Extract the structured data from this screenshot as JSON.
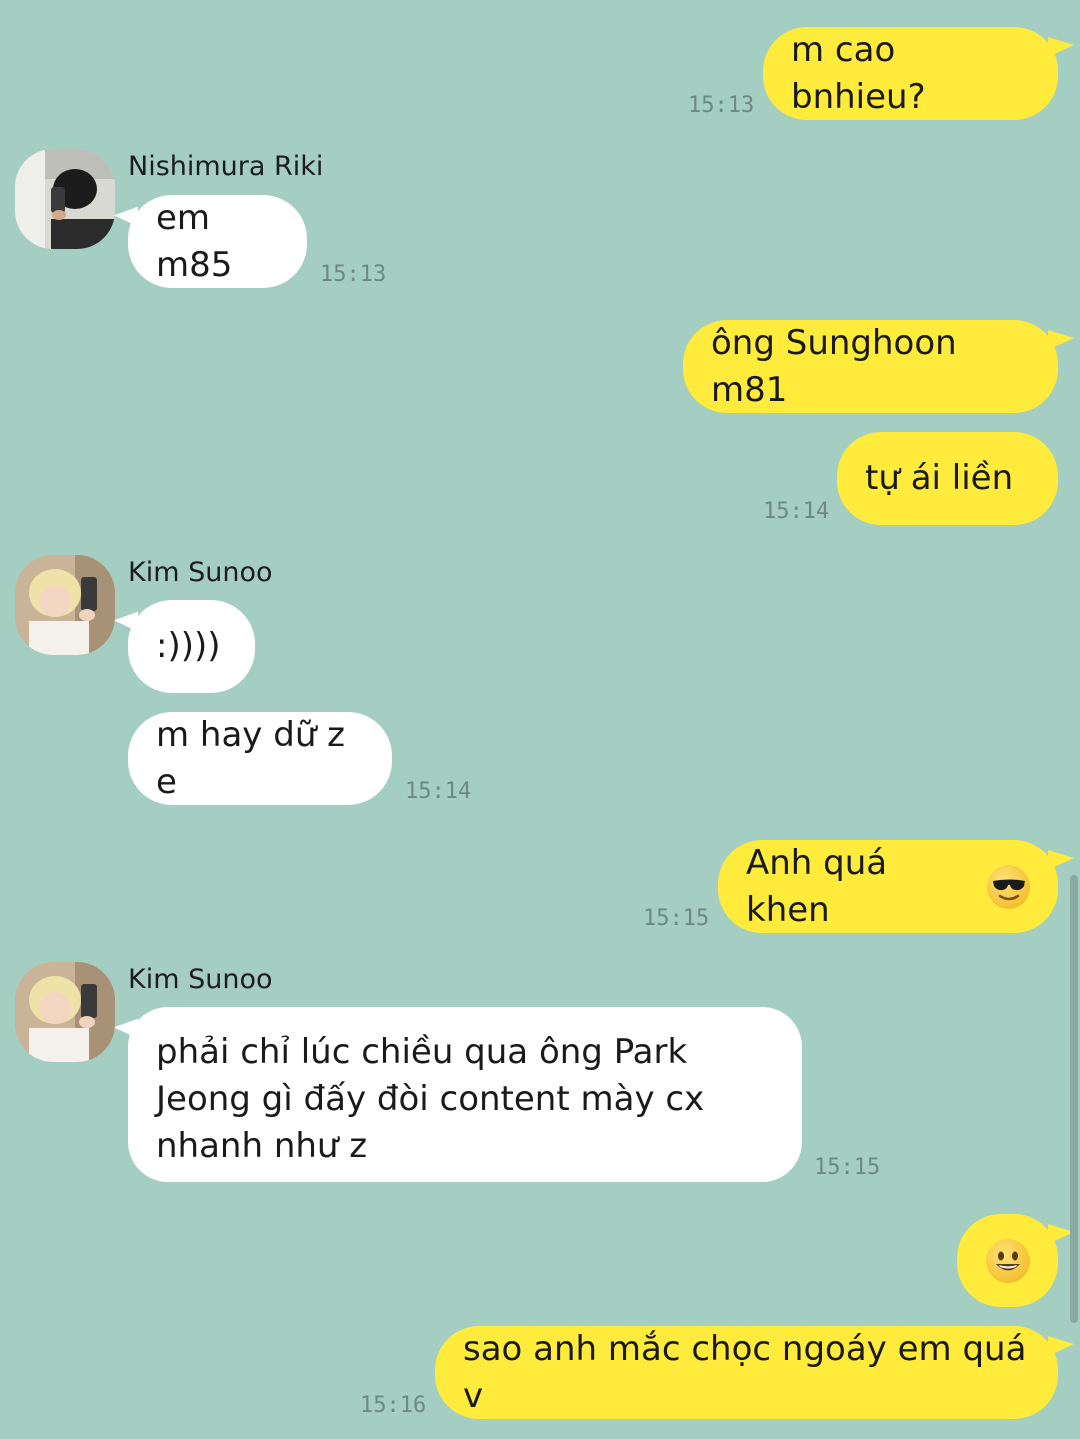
{
  "colors": {
    "background": "#a5cec2",
    "my_bubble": "#ffeb3b",
    "their_bubble": "#ffffff",
    "timestamp": "#6a8a83"
  },
  "messages": [
    {
      "sender": "me",
      "text": "m cao bnhieu?",
      "time": "15:13"
    },
    {
      "sender": "Nishimura Riki",
      "text": "em m85",
      "time": "15:13"
    },
    {
      "sender": "me",
      "text": "ông Sunghoon m81"
    },
    {
      "sender": "me",
      "text": "tự ái liền",
      "time": "15:14"
    },
    {
      "sender": "Kim Sunoo",
      "text": ":))))"
    },
    {
      "sender": "Kim Sunoo",
      "text": "m hay dữ z e",
      "time": "15:14"
    },
    {
      "sender": "me",
      "text": "Anh quá khen",
      "emoji": "sunglasses-face",
      "time": "15:15"
    },
    {
      "sender": "Kim Sunoo",
      "text_lines": [
        "phải chỉ lúc chiều qua ông Park",
        "Jeong gì đấy đòi content mày cx",
        "nhanh như z"
      ],
      "time": "15:15"
    },
    {
      "sender": "me",
      "emoji": "grinning-face"
    },
    {
      "sender": "me",
      "text": "sao anh mắc chọc ngoáy em quá v",
      "time": "15:16"
    }
  ],
  "contacts": {
    "riki": {
      "name": "Nishimura Riki",
      "avatar": "avatar-photo"
    },
    "sunoo": {
      "name": "Kim Sunoo",
      "avatar": "avatar-photo"
    }
  }
}
